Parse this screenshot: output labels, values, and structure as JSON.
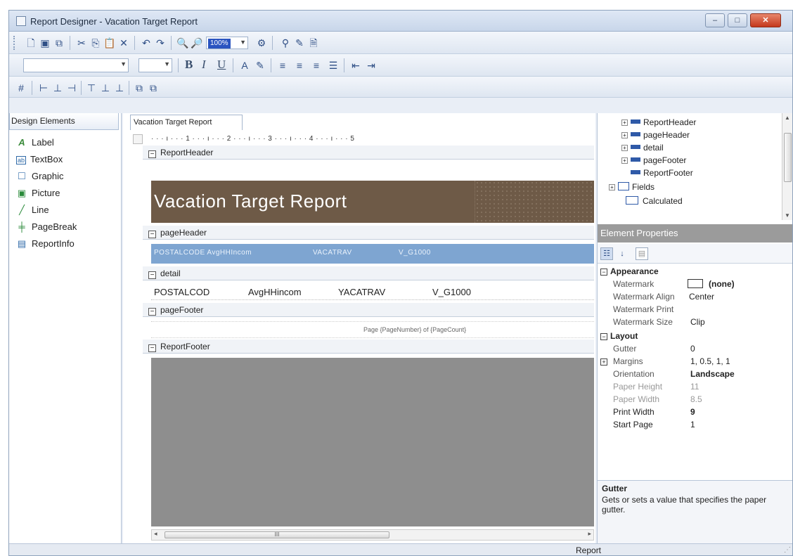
{
  "window": {
    "title": "Report Designer - Vacation Target Report",
    "min": "–",
    "max": "□",
    "close": "✕"
  },
  "toolbar1": {
    "zoom": "100%"
  },
  "toolbar2": {
    "bold": "B",
    "italic": "I",
    "underline": "U"
  },
  "design_elements": {
    "header": "Design Elements",
    "items": [
      {
        "label": "Label",
        "icon": "label-icon",
        "glyph": "A"
      },
      {
        "label": "TextBox",
        "icon": "textbox-icon",
        "glyph": "ab"
      },
      {
        "label": "Graphic",
        "icon": "graphic-icon",
        "glyph": "□"
      },
      {
        "label": "Picture",
        "icon": "picture-icon",
        "glyph": "▣"
      },
      {
        "label": "Line",
        "icon": "line-icon",
        "glyph": "╱"
      },
      {
        "label": "PageBreak",
        "icon": "pagebreak-icon",
        "glyph": "╪"
      },
      {
        "label": "ReportInfo",
        "icon": "reportinfo-icon",
        "glyph": "▤"
      }
    ]
  },
  "designer": {
    "tab": "Vacation Target Report",
    "ruler": "· · · ı · · · 1 · · · ı · · · 2 · · · ı · · · 3 · · · ı · · · 4 · · · ı · · · 5",
    "sections": {
      "report_header": "ReportHeader",
      "page_header": "pageHeader",
      "detail": "detail",
      "page_footer": "pageFooter",
      "report_footer": "ReportFooter"
    },
    "title_text": "Vacation Target Report",
    "page_header_fields": [
      "POSTALCODE AvgHHIncom",
      "VACATRAV",
      "V_G1000"
    ],
    "detail_fields": [
      "POSTALCOD",
      "AvgHHincom",
      "YACATRAV",
      "V_G1000"
    ],
    "page_footer_text": "Page {PageNumber} of {PageCount}",
    "scroll_marker": "III"
  },
  "tree": {
    "nodes": [
      "ReportHeader",
      "pageHeader",
      "detail",
      "pageFooter",
      "ReportFooter"
    ],
    "fields": "Fields",
    "calculated": "Calculated"
  },
  "element_properties": {
    "header": "Element Properties",
    "appearance": {
      "title": "Appearance",
      "rows": [
        {
          "name": "Watermark",
          "value": "(none)"
        },
        {
          "name": "Watermark Align",
          "value": "Center"
        },
        {
          "name": "Watermark Print",
          "value": ""
        },
        {
          "name": "Watermark Size",
          "value": "Clip"
        }
      ]
    },
    "layout": {
      "title": "Layout",
      "rows": [
        {
          "name": "Gutter",
          "value": "0"
        },
        {
          "name": "Margins",
          "value": "1, 0.5, 1, 1"
        },
        {
          "name": "Orientation",
          "value": "Landscape"
        },
        {
          "name": "Paper Height",
          "value": "11"
        },
        {
          "name": "Paper Width",
          "value": "8.5"
        },
        {
          "name": "Print Width",
          "value": "9"
        },
        {
          "name": "Start Page",
          "value": "1"
        }
      ]
    },
    "desc_title": "Gutter",
    "desc_text": "Gets or sets a value that specifies the paper gutter."
  },
  "status": {
    "text": "Report"
  }
}
